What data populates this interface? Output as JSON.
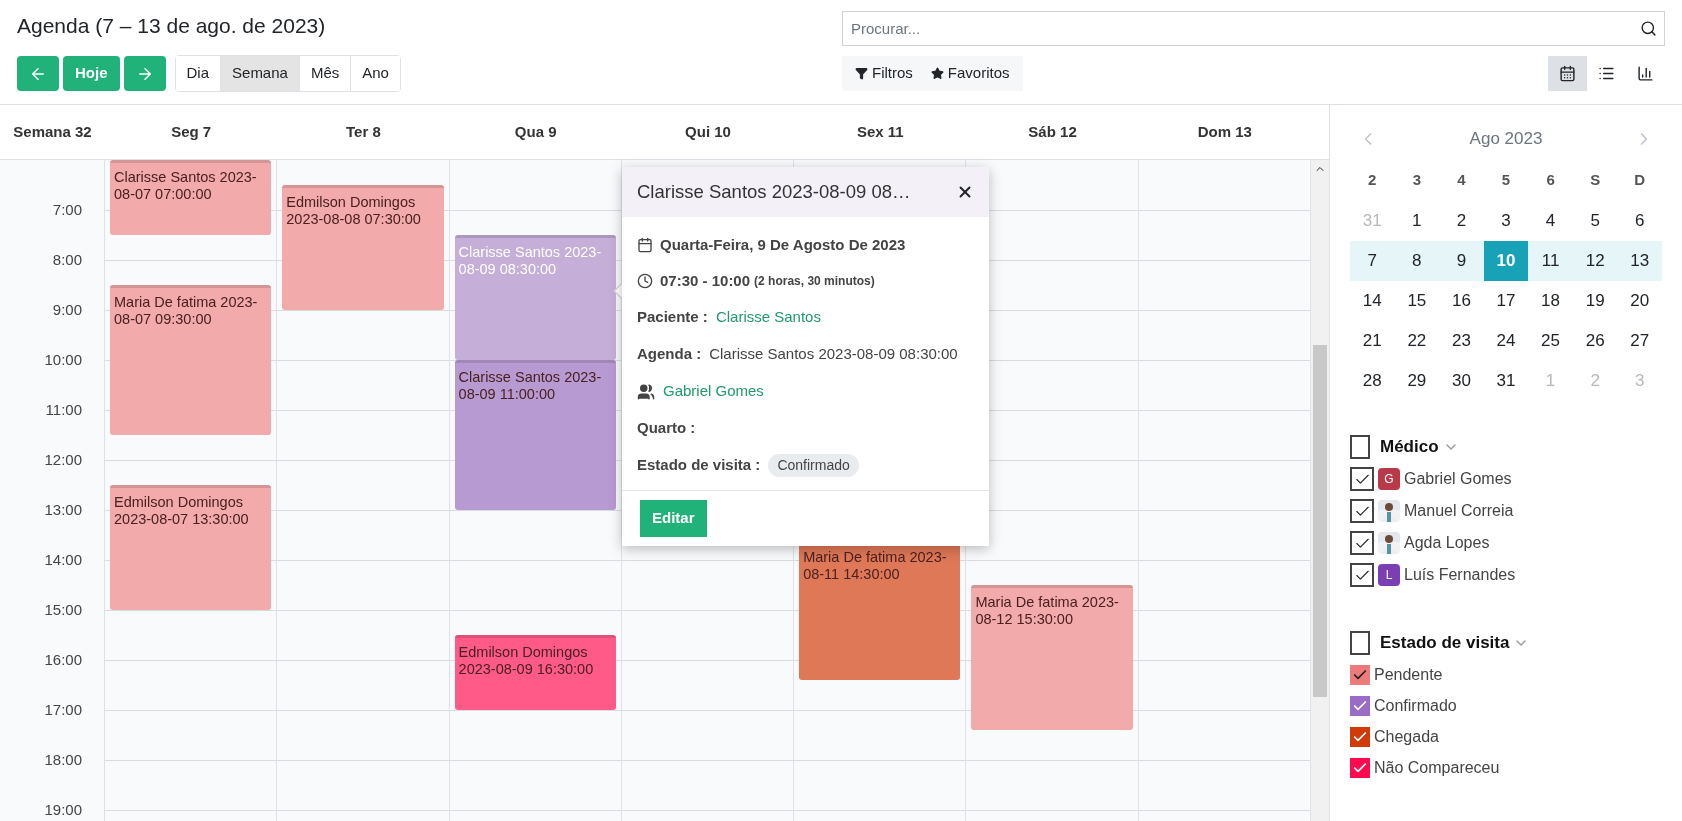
{
  "title": "Agenda (7 – 13 de ago. de 2023)",
  "nav_buttons": [
    {
      "kind": "prev"
    },
    {
      "kind": "today",
      "label": "Hoje"
    },
    {
      "kind": "next"
    }
  ],
  "scales": [
    {
      "label": "Dia",
      "selected": false
    },
    {
      "label": "Semana",
      "selected": true
    },
    {
      "label": "Mês",
      "selected": false
    },
    {
      "label": "Ano",
      "selected": false
    }
  ],
  "search": {
    "placeholder": "Procurar..."
  },
  "filter_buttons": [
    {
      "kind": "filter",
      "label": "Filtros"
    },
    {
      "kind": "favorite",
      "label": "Favoritos"
    }
  ],
  "views": [
    {
      "kind": "calendar",
      "selected": true
    },
    {
      "kind": "list",
      "selected": false
    },
    {
      "kind": "graph",
      "selected": false
    }
  ],
  "week_label": "Semana 32",
  "hours": [
    "7:00",
    "8:00",
    "9:00",
    "10:00",
    "11:00",
    "12:00",
    "13:00",
    "14:00",
    "15:00",
    "16:00",
    "17:00",
    "18:00",
    "19:00"
  ],
  "days": [
    {
      "label": "Seg 7",
      "events": [
        {
          "text": "Clarisse Santos 2023-08-07 07:00:00",
          "color": "#f2aaaa",
          "selected": false
        },
        {
          "text": "Maria De fatima 2023-08-07 09:30:00",
          "color": "#f2aaaa",
          "selected": false
        },
        {
          "text": "Edmilson Domingos 2023-08-07 13:30:00",
          "color": "#f2aaaa",
          "selected": false
        }
      ]
    },
    {
      "label": "Ter 8",
      "events": [
        {
          "text": "Edmilson Domingos 2023-08-08 07:30:00",
          "color": "#f2aaaa",
          "selected": false
        }
      ]
    },
    {
      "label": "Qua 9",
      "events": [
        {
          "text": "Clarisse Santos 2023-08-09 08:30:00",
          "color": "#c5aed8",
          "selected": true
        },
        {
          "text": "Clarisse Santos 2023-08-09 11:00:00",
          "color": "#b89ad2",
          "selected": false
        },
        {
          "text": "Edmilson Domingos 2023-08-09 16:30:00",
          "color": "#ff5a88",
          "selected": false
        }
      ]
    },
    {
      "label": "Qui 10"
    },
    {
      "label": "Sex 11",
      "events": [
        {
          "text": "Maria De fatima 2023-08-11 14:30:00",
          "color": "#df7857",
          "selected": false
        }
      ]
    },
    {
      "label": "Sáb 12",
      "events": [
        {
          "text": "Maria De fatima 2023-08-12 15:30:00",
          "color": "#f2aaaa",
          "selected": false
        }
      ]
    },
    {
      "label": "Dom 13"
    }
  ],
  "popover": {
    "title": "Clarisse Santos 2023-08-09 08…",
    "date": "Quarta-Feira, 9 De Agosto De 2023",
    "time": "07:30 - 10:00",
    "duration": "(2 horas, 30 minutos)",
    "fields": [
      {
        "kind": "link",
        "label": "Paciente :",
        "value": "Clarisse Santos"
      },
      {
        "kind": "text",
        "label": "Agenda :",
        "value": "Clarisse Santos 2023-08-09 08:30:00"
      },
      {
        "kind": "attendee",
        "value": "Gabriel Gomes"
      },
      {
        "kind": "empty",
        "label": "Quarto :"
      },
      {
        "kind": "badge",
        "label": "Estado de visita :",
        "value": "Confirmado"
      }
    ],
    "button": "Editar"
  },
  "mini_calendar": {
    "title": "Ago 2023",
    "weekdays": [
      "2",
      "3",
      "4",
      "5",
      "6",
      "S",
      "D"
    ],
    "weeks": [
      {
        "highlighted": false,
        "days": [
          {
            "label": "31",
            "muted": true,
            "selected": false
          },
          {
            "label": "1",
            "muted": false,
            "selected": false
          },
          {
            "label": "2",
            "muted": false,
            "selected": false
          },
          {
            "label": "3",
            "muted": false,
            "selected": false
          },
          {
            "label": "4",
            "muted": false,
            "selected": false
          },
          {
            "label": "5",
            "muted": false,
            "selected": false
          },
          {
            "label": "6",
            "muted": false,
            "selected": false
          }
        ]
      },
      {
        "highlighted": true,
        "days": [
          {
            "label": "7",
            "muted": false,
            "selected": false
          },
          {
            "label": "8",
            "muted": false,
            "selected": false
          },
          {
            "label": "9",
            "muted": false,
            "selected": false
          },
          {
            "label": "10",
            "muted": false,
            "selected": true
          },
          {
            "label": "11",
            "muted": false,
            "selected": false
          },
          {
            "label": "12",
            "muted": false,
            "selected": false
          },
          {
            "label": "13",
            "muted": false,
            "selected": false
          }
        ]
      },
      {
        "highlighted": false,
        "days": [
          {
            "label": "14",
            "muted": false,
            "selected": false
          },
          {
            "label": "15",
            "muted": false,
            "selected": false
          },
          {
            "label": "16",
            "muted": false,
            "selected": false
          },
          {
            "label": "17",
            "muted": false,
            "selected": false
          },
          {
            "label": "18",
            "muted": false,
            "selected": false
          },
          {
            "label": "19",
            "muted": false,
            "selected": false
          },
          {
            "label": "20",
            "muted": false,
            "selected": false
          }
        ]
      },
      {
        "highlighted": false,
        "days": [
          {
            "label": "21",
            "muted": false,
            "selected": false
          },
          {
            "label": "22",
            "muted": false,
            "selected": false
          },
          {
            "label": "23",
            "muted": false,
            "selected": false
          },
          {
            "label": "24",
            "muted": false,
            "selected": false
          },
          {
            "label": "25",
            "muted": false,
            "selected": false
          },
          {
            "label": "26",
            "muted": false,
            "selected": false
          },
          {
            "label": "27",
            "muted": false,
            "selected": false
          }
        ]
      },
      {
        "highlighted": false,
        "days": [
          {
            "label": "28",
            "muted": false,
            "selected": false
          },
          {
            "label": "29",
            "muted": false,
            "selected": false
          },
          {
            "label": "30",
            "muted": false,
            "selected": false
          },
          {
            "label": "31",
            "muted": false,
            "selected": false
          },
          {
            "label": "1",
            "muted": true,
            "selected": false
          },
          {
            "label": "2",
            "muted": true,
            "selected": false
          },
          {
            "label": "3",
            "muted": true,
            "selected": false
          }
        ]
      }
    ]
  },
  "filters": [
    {
      "title": "Médico",
      "checked": false,
      "items": [
        {
          "label": "Gabriel Gomes",
          "checked": true,
          "avatar": {
            "kind": "letter",
            "letter": "G",
            "color": "#b83a48"
          }
        },
        {
          "label": "Manuel Correia",
          "checked": true
        },
        {
          "label": "Agda Lopes",
          "checked": true
        },
        {
          "label": "Luís Fernandes",
          "checked": true,
          "avatar": {
            "kind": "letter",
            "letter": "L",
            "color": "#7b3fb3"
          }
        }
      ]
    },
    {
      "title": "Estado de visita",
      "checked": false,
      "items": [
        {
          "label": "Pendente",
          "checked": true,
          "color": "#ee7b7b"
        },
        {
          "label": "Confirmado",
          "checked": true,
          "color": "#9b6cc6"
        },
        {
          "label": "Chegada",
          "checked": true,
          "color": "#d13b0a"
        },
        {
          "label": "Não Compareceu",
          "checked": true,
          "color": "#ff0a50"
        }
      ]
    }
  ]
}
